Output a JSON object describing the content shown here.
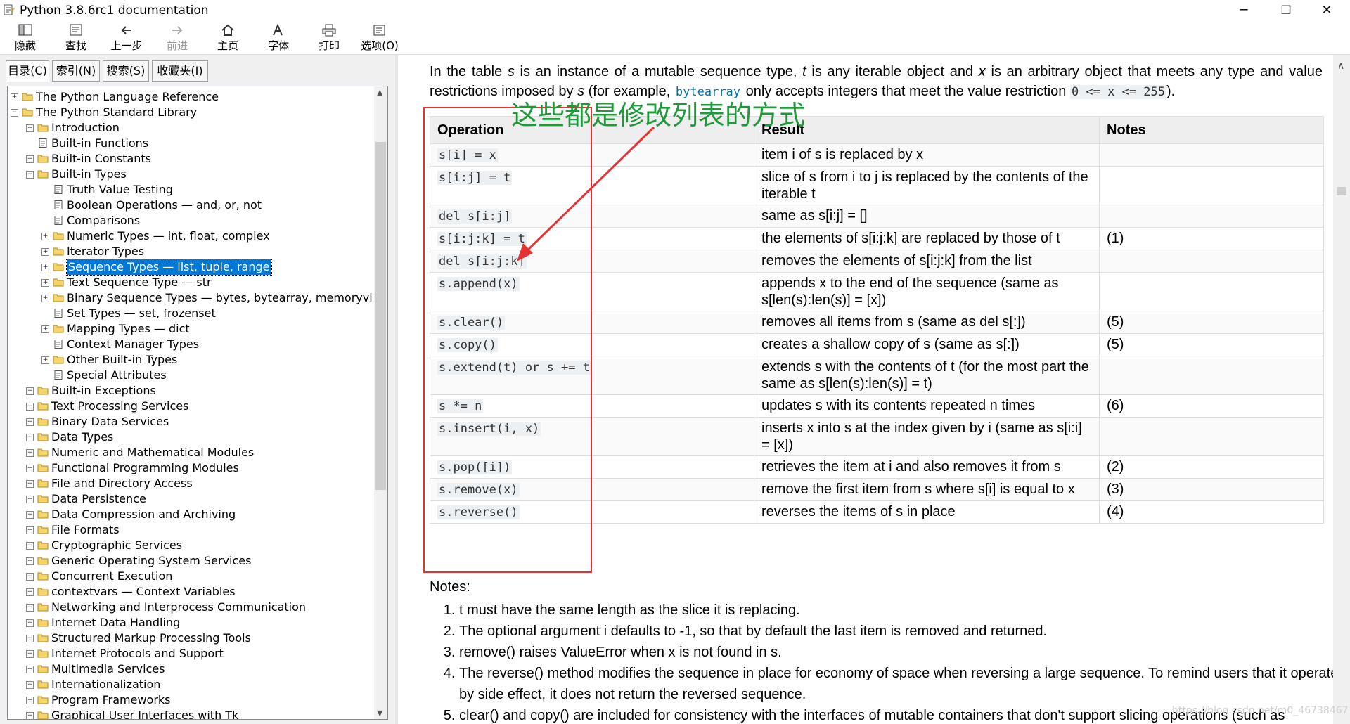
{
  "window": {
    "title": "Python 3.8.6rc1 documentation",
    "buttons": {
      "minimize": "─",
      "maximize": "❐",
      "close": "✕"
    }
  },
  "toolbar": {
    "items": [
      {
        "label": "隐藏",
        "icon": "hide-pane-icon"
      },
      {
        "label": "查找",
        "icon": "locate-icon"
      },
      {
        "label": "上一步",
        "icon": "back-arrow-icon"
      },
      {
        "label": "前进",
        "icon": "forward-arrow-icon"
      },
      {
        "label": "主页",
        "icon": "home-icon"
      },
      {
        "label": "字体",
        "icon": "font-icon"
      },
      {
        "label": "打印",
        "icon": "printer-icon"
      },
      {
        "label": "选项(O)",
        "icon": "options-icon"
      }
    ]
  },
  "nav_tabs": [
    "目录(C)",
    "索引(N)",
    "搜索(S)",
    "收藏夹(I)"
  ],
  "tree": [
    {
      "label": "The Python Language Reference",
      "level": 0,
      "exp": "+",
      "icon": "folder"
    },
    {
      "label": "The Python Standard Library",
      "level": 0,
      "exp": "-",
      "icon": "folder-open"
    },
    {
      "label": "Introduction",
      "level": 1,
      "exp": "+",
      "icon": "folder"
    },
    {
      "label": "Built-in Functions",
      "level": 1,
      "exp": "",
      "icon": "page"
    },
    {
      "label": "Built-in Constants",
      "level": 1,
      "exp": "+",
      "icon": "folder"
    },
    {
      "label": "Built-in Types",
      "level": 1,
      "exp": "-",
      "icon": "folder-open"
    },
    {
      "label": "Truth Value Testing",
      "level": 2,
      "exp": "",
      "icon": "page"
    },
    {
      "label": "Boolean Operations — and, or, not",
      "level": 2,
      "exp": "",
      "icon": "page"
    },
    {
      "label": "Comparisons",
      "level": 2,
      "exp": "",
      "icon": "page"
    },
    {
      "label": "Numeric Types — int, float, complex",
      "level": 2,
      "exp": "+",
      "icon": "folder"
    },
    {
      "label": "Iterator Types",
      "level": 2,
      "exp": "+",
      "icon": "folder"
    },
    {
      "label": "Sequence Types — list, tuple, range",
      "level": 2,
      "exp": "+",
      "icon": "folder",
      "selected": true
    },
    {
      "label": "Text Sequence Type — str",
      "level": 2,
      "exp": "+",
      "icon": "folder"
    },
    {
      "label": "Binary Sequence Types — bytes, bytearray, memoryview",
      "level": 2,
      "exp": "+",
      "icon": "folder"
    },
    {
      "label": "Set Types — set, frozenset",
      "level": 2,
      "exp": "",
      "icon": "page"
    },
    {
      "label": "Mapping Types — dict",
      "level": 2,
      "exp": "+",
      "icon": "folder"
    },
    {
      "label": "Context Manager Types",
      "level": 2,
      "exp": "",
      "icon": "page"
    },
    {
      "label": "Other Built-in Types",
      "level": 2,
      "exp": "+",
      "icon": "folder"
    },
    {
      "label": "Special Attributes",
      "level": 2,
      "exp": "",
      "icon": "page"
    },
    {
      "label": "Built-in Exceptions",
      "level": 1,
      "exp": "+",
      "icon": "folder"
    },
    {
      "label": "Text Processing Services",
      "level": 1,
      "exp": "+",
      "icon": "folder"
    },
    {
      "label": "Binary Data Services",
      "level": 1,
      "exp": "+",
      "icon": "folder"
    },
    {
      "label": "Data Types",
      "level": 1,
      "exp": "+",
      "icon": "folder"
    },
    {
      "label": "Numeric and Mathematical Modules",
      "level": 1,
      "exp": "+",
      "icon": "folder"
    },
    {
      "label": "Functional Programming Modules",
      "level": 1,
      "exp": "+",
      "icon": "folder"
    },
    {
      "label": "File and Directory Access",
      "level": 1,
      "exp": "+",
      "icon": "folder"
    },
    {
      "label": "Data Persistence",
      "level": 1,
      "exp": "+",
      "icon": "folder"
    },
    {
      "label": "Data Compression and Archiving",
      "level": 1,
      "exp": "+",
      "icon": "folder"
    },
    {
      "label": "File Formats",
      "level": 1,
      "exp": "+",
      "icon": "folder"
    },
    {
      "label": "Cryptographic Services",
      "level": 1,
      "exp": "+",
      "icon": "folder"
    },
    {
      "label": "Generic Operating System Services",
      "level": 1,
      "exp": "+",
      "icon": "folder"
    },
    {
      "label": "Concurrent Execution",
      "level": 1,
      "exp": "+",
      "icon": "folder"
    },
    {
      "label": "contextvars — Context Variables",
      "level": 1,
      "exp": "+",
      "icon": "folder"
    },
    {
      "label": "Networking and Interprocess Communication",
      "level": 1,
      "exp": "+",
      "icon": "folder"
    },
    {
      "label": "Internet Data Handling",
      "level": 1,
      "exp": "+",
      "icon": "folder"
    },
    {
      "label": "Structured Markup Processing Tools",
      "level": 1,
      "exp": "+",
      "icon": "folder"
    },
    {
      "label": "Internet Protocols and Support",
      "level": 1,
      "exp": "+",
      "icon": "folder"
    },
    {
      "label": "Multimedia Services",
      "level": 1,
      "exp": "+",
      "icon": "folder"
    },
    {
      "label": "Internationalization",
      "level": 1,
      "exp": "+",
      "icon": "folder"
    },
    {
      "label": "Program Frameworks",
      "level": 1,
      "exp": "+",
      "icon": "folder"
    },
    {
      "label": "Graphical User Interfaces with Tk",
      "level": 1,
      "exp": "+",
      "icon": "folder"
    }
  ],
  "content": {
    "intro": {
      "p1": "In the table ",
      "s": "s",
      "p2": " is an instance of a mutable sequence type, ",
      "t": "t",
      "p3": " is any iterable object and ",
      "x": "x",
      "p4": " is an arbitrary object that meets any type and value restrictions imposed by ",
      "s2": "s",
      "p5": " (for example, ",
      "bytearray": "bytearray",
      "p6": " only accepts integers that meet the value restriction ",
      "restriction": "0 <= x <= 255",
      "p7": ")."
    },
    "table": {
      "headers": [
        "Operation",
        "Result",
        "Notes"
      ],
      "rows": [
        {
          "op": "s[i] = x",
          "result": "item i of s is replaced by x",
          "note": ""
        },
        {
          "op": "s[i:j] = t",
          "result": "slice of s from i to j is replaced by the contents of the iterable t",
          "note": ""
        },
        {
          "op": "del s[i:j]",
          "result": "same as s[i:j] = []",
          "note": ""
        },
        {
          "op": "s[i:j:k] = t",
          "result": "the elements of s[i:j:k] are replaced by those of t",
          "note": "(1)"
        },
        {
          "op": "del s[i:j:k]",
          "result": "removes the elements of s[i:j:k] from the list",
          "note": ""
        },
        {
          "op": "s.append(x)",
          "result": "appends x to the end of the sequence (same as s[len(s):len(s)] = [x])",
          "note": ""
        },
        {
          "op": "s.clear()",
          "result": "removes all items from s (same as del s[:])",
          "note": "(5)"
        },
        {
          "op": "s.copy()",
          "result": "creates a shallow copy of s (same as s[:])",
          "note": "(5)"
        },
        {
          "op": "s.extend(t) or s += t",
          "result": "extends s with the contents of t (for the most part the same as s[len(s):len(s)] = t)",
          "note": ""
        },
        {
          "op": "s *= n",
          "result": "updates s with its contents repeated n times",
          "note": "(6)"
        },
        {
          "op": "s.insert(i, x)",
          "result": "inserts x into s at the index given by i (same as s[i:i] = [x])",
          "note": ""
        },
        {
          "op": "s.pop([i])",
          "result": "retrieves the item at i and also removes it from s",
          "note": "(2)"
        },
        {
          "op": "s.remove(x)",
          "result": "remove the first item from s where s[i] is equal to x",
          "note": "(3)"
        },
        {
          "op": "s.reverse()",
          "result": "reverses the items of s in place",
          "note": "(4)"
        }
      ]
    },
    "annotation": "这些都是修改列表的方式",
    "notes_heading": "Notes:",
    "notes": [
      "t must have the same length as the slice it is replacing.",
      "The optional argument i defaults to -1, so that by default the last item is removed and returned.",
      "remove() raises ValueError when x is not found in s.",
      "The reverse() method modifies the sequence in place for economy of space when reversing a large sequence. To remind users that it operates by side effect, it does not return the reversed sequence.",
      "clear() and copy() are included for consistency with the interfaces of mutable containers that don't support slicing operations (such as"
    ]
  },
  "watermark": "https://blog.csdn.net/m0_46738467",
  "colors": {
    "selection": "#0078d7",
    "annotation_red": "#e53333",
    "annotation_green": "#1f9a3a",
    "link": "#0072aa"
  }
}
